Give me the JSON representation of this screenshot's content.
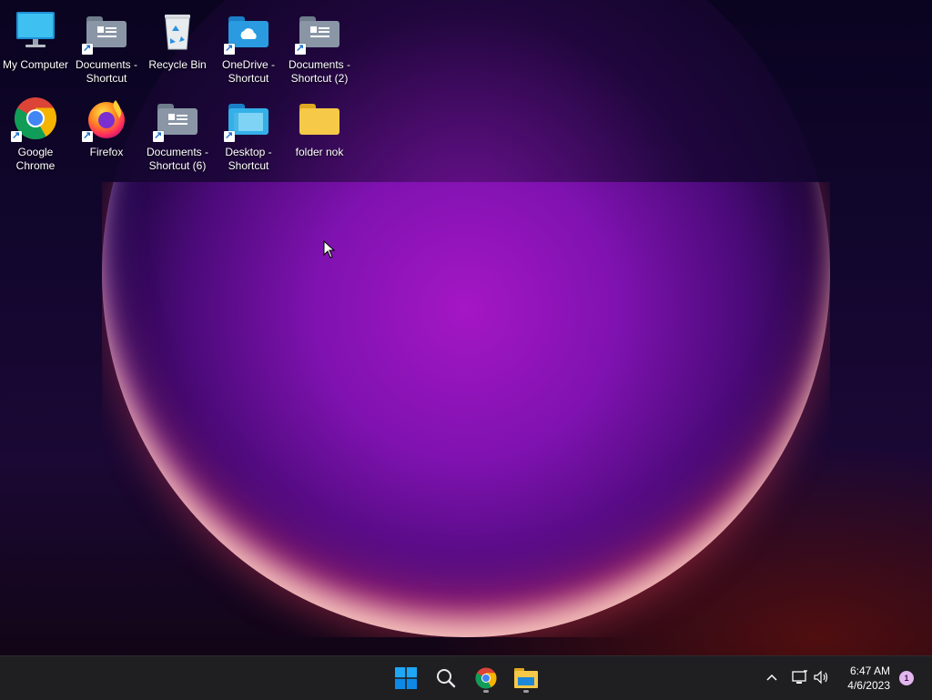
{
  "desktop": {
    "icons": [
      {
        "label": "My Computer",
        "icon": "monitor-icon",
        "shortcut": false
      },
      {
        "label": "Documents - Shortcut",
        "icon": "folder-documents-icon",
        "shortcut": true
      },
      {
        "label": "Recycle Bin",
        "icon": "recycle-bin-icon",
        "shortcut": false
      },
      {
        "label": "OneDrive - Shortcut",
        "icon": "folder-onedrive-icon",
        "shortcut": true
      },
      {
        "label": "Documents - Shortcut (2)",
        "icon": "folder-documents-icon",
        "shortcut": true
      },
      {
        "label": "Google Chrome",
        "icon": "chrome-icon",
        "shortcut": true
      },
      {
        "label": "Firefox",
        "icon": "firefox-icon",
        "shortcut": true
      },
      {
        "label": "Documents - Shortcut (6)",
        "icon": "folder-documents-icon",
        "shortcut": true
      },
      {
        "label": "Desktop - Shortcut",
        "icon": "folder-desktop-icon",
        "shortcut": true
      },
      {
        "label": "folder nok",
        "icon": "folder-icon",
        "shortcut": false
      }
    ]
  },
  "taskbar": {
    "pinned": [
      {
        "name": "start",
        "icon": "windows-start-icon"
      },
      {
        "name": "search",
        "icon": "search-icon"
      },
      {
        "name": "chrome",
        "icon": "chrome-icon",
        "running": true
      },
      {
        "name": "file-explorer",
        "icon": "file-explorer-icon",
        "running": true
      }
    ],
    "tray": {
      "chevron_icon": "chevron-up-icon",
      "network_icon": "network-icon",
      "volume_icon": "volume-icon",
      "time": "6:47 AM",
      "date": "4/6/2023",
      "notification_count": "1"
    }
  },
  "colors": {
    "taskbar_bg": "#1f1f22",
    "accent": "#0078d4",
    "folder_yellow": "#f7c948",
    "folder_blue": "#2a9be0",
    "folder_gray": "#8a96a6"
  }
}
